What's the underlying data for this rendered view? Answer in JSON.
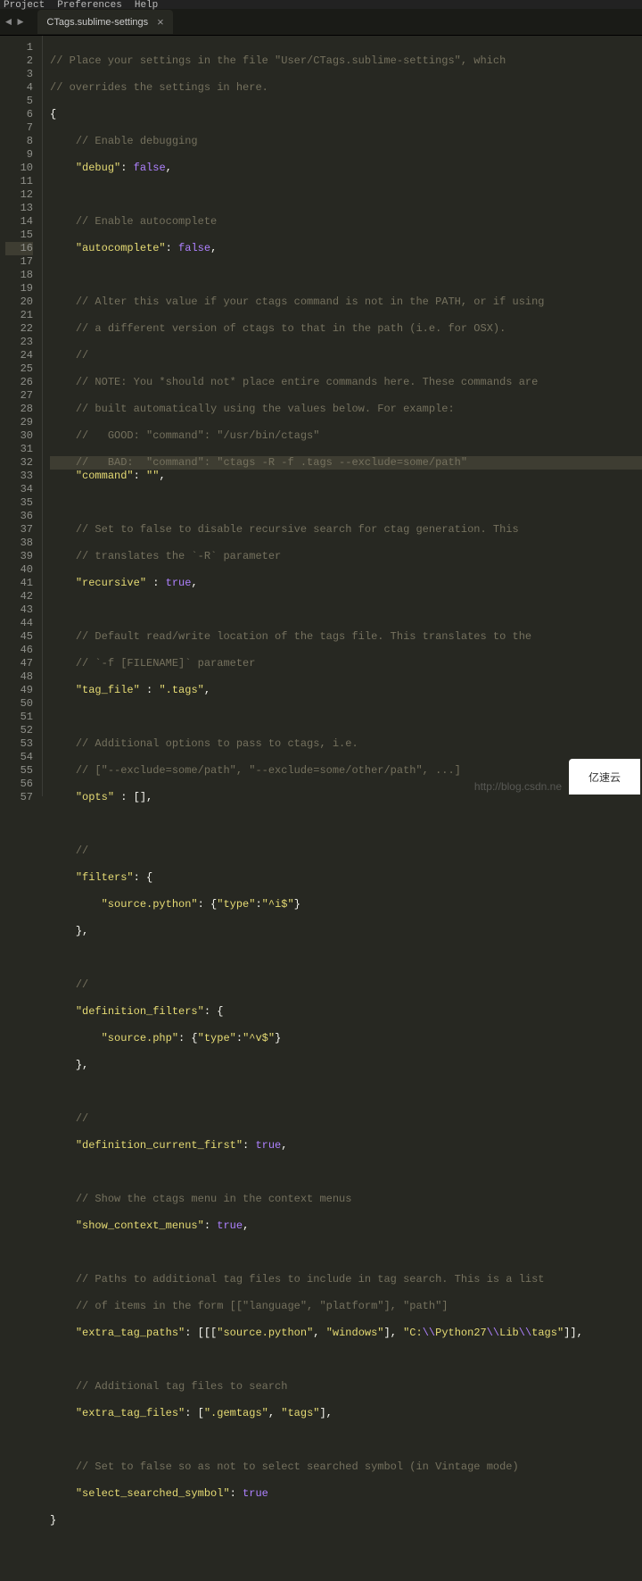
{
  "menubar": {
    "project": "Project",
    "preferences": "Preferences",
    "help": "Help"
  },
  "tab": {
    "title": "CTags.sublime-settings",
    "close": "×"
  },
  "nav": {
    "back": "◄",
    "forward": "►"
  },
  "watermark": "http://blog.csdn.ne",
  "lines": {
    "n1": "1",
    "n2": "2",
    "n3": "3",
    "n4": "4",
    "n5": "5",
    "n6": "6",
    "n7": "7",
    "n8": "8",
    "n9": "9",
    "n10": "10",
    "n11": "11",
    "n12": "12",
    "n13": "13",
    "n14": "14",
    "n15": "15",
    "n16": "16",
    "n17": "17",
    "n18": "18",
    "n19": "19",
    "n20": "20",
    "n21": "21",
    "n22": "22",
    "n23": "23",
    "n24": "24",
    "n25": "25",
    "n26": "26",
    "n27": "27",
    "n28": "28",
    "n29": "29",
    "n30": "30",
    "n31": "31",
    "n32": "32",
    "n33": "33",
    "n34": "34",
    "n35": "35",
    "n36": "36",
    "n37": "37",
    "n38": "38",
    "n39": "39",
    "n40": "40",
    "n41": "41",
    "n42": "42",
    "n43": "43",
    "n44": "44",
    "n45": "45",
    "n46": "46",
    "n47": "47",
    "n48": "48",
    "n49": "49",
    "n50": "50",
    "n51": "51",
    "n52": "52",
    "n53": "53",
    "n54": "54",
    "n55": "55",
    "n56": "56",
    "n57": "57"
  },
  "code": {
    "c1": "// Place your settings in the file \"User/CTags.sublime-settings\", which",
    "c2": "// overrides the settings in here.",
    "p3": "{",
    "c4": "// Enable debugging",
    "s5a": "\"debug\"",
    "p5a": ": ",
    "k5": "false",
    "p5b": ",",
    "c7": "// Enable autocomplete",
    "s8a": "\"autocomplete\"",
    "p8a": ": ",
    "k8": "false",
    "p8b": ",",
    "c10": "// Alter this value if your ctags command is not in the PATH, or if using",
    "c11": "// a different version of ctags to that in the path (i.e. for OSX).",
    "c12": "//",
    "c13": "// NOTE: You *should not* place entire commands here. These commands are",
    "c14": "// built automatically using the values below. For example:",
    "c15": "//   GOOD: \"command\": \"/usr/bin/ctags\"",
    "c16": "//   BAD:  \"command\": \"ctags -R -f .tags --exclude=some/path\"",
    "s17a": "\"command\"",
    "p17a": ": ",
    "s17b": "\"\"",
    "p17b": ",",
    "c19": "// Set to false to disable recursive search for ctag generation. This",
    "c20": "// translates the `-R` parameter",
    "s21a": "\"recursive\"",
    "p21a": " : ",
    "k21": "true",
    "p21b": ",",
    "c23": "// Default read/write location of the tags file. This translates to the",
    "c24": "// `-f [FILENAME]` parameter",
    "s25a": "\"tag_file\"",
    "p25a": " : ",
    "s25b": "\".tags\"",
    "p25b": ",",
    "c27": "// Additional options to pass to ctags, i.e.",
    "c28": "// [\"--exclude=some/path\", \"--exclude=some/other/path\", ...]",
    "s29a": "\"opts\"",
    "p29a": " : [],",
    "c31": "//",
    "s32a": "\"filters\"",
    "p32a": ": {",
    "s33a": "\"source.python\"",
    "p33a": ": {",
    "s33b": "\"type\"",
    "p33b": ":",
    "s33c": "\"^i$\"",
    "p33c": "}",
    "p34": "},",
    "c36": "//",
    "s37a": "\"definition_filters\"",
    "p37a": ": {",
    "s38a": "\"source.php\"",
    "p38a": ": {",
    "s38b": "\"type\"",
    "p38b": ":",
    "s38c": "\"^v$\"",
    "p38c": "}",
    "p39": "},",
    "c41": "//",
    "s42a": "\"definition_current_first\"",
    "p42a": ": ",
    "k42": "true",
    "p42b": ",",
    "c44": "// Show the ctags menu in the context menus",
    "s45a": "\"show_context_menus\"",
    "p45a": ": ",
    "k45": "true",
    "p45b": ",",
    "c47": "// Paths to additional tag files to include in tag search. This is a list",
    "c48": "// of items in the form [[\"language\", \"platform\"], \"path\"]",
    "s49a": "\"extra_tag_paths\"",
    "p49a": ": [[[",
    "s49b": "\"source.python\"",
    "p49b": ", ",
    "s49c": "\"windows\"",
    "p49c": "], ",
    "s49d": "\"C:",
    "e49a": "\\\\",
    "s49e": "Python27",
    "e49b": "\\\\",
    "s49f": "Lib",
    "e49c": "\\\\",
    "s49g": "tags\"",
    "p49d": "]],",
    "c51": "// Additional tag files to search",
    "s52a": "\"extra_tag_files\"",
    "p52a": ": [",
    "s52b": "\".gemtags\"",
    "p52b": ", ",
    "s52c": "\"tags\"",
    "p52c": "],",
    "c54": "// Set to false so as not to select searched symbol (in Vintage mode)",
    "s55a": "\"select_searched_symbol\"",
    "p55a": ": ",
    "k55": "true",
    "p56": "}"
  },
  "logo_text": "亿速云"
}
